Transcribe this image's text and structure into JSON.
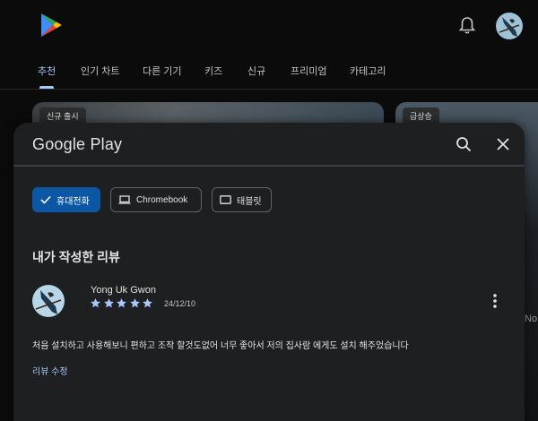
{
  "header": {
    "logo_icon": "google-play-logo",
    "notifications_icon": "bell-icon",
    "account_icon": "avatar"
  },
  "nav": {
    "tabs": [
      {
        "label": "추천",
        "active": true
      },
      {
        "label": "인기 차트",
        "active": false
      },
      {
        "label": "다른 기기",
        "active": false
      },
      {
        "label": "키즈",
        "active": false
      },
      {
        "label": "신규",
        "active": false
      },
      {
        "label": "프리미엄",
        "active": false
      },
      {
        "label": "카테고리",
        "active": false
      }
    ]
  },
  "background": {
    "card_left_chip": "신규 출시",
    "card_right_chip": "급상승",
    "peek_no": "No"
  },
  "dialog": {
    "title": "Google Play",
    "search_icon": "search-icon",
    "close_icon": "close-icon",
    "filters": [
      {
        "label": "휴대전화",
        "icon": "check-icon",
        "selected": true
      },
      {
        "label": "Chromebook",
        "icon": "laptop-icon",
        "selected": false
      },
      {
        "label": "태블릿",
        "icon": "tablet-icon",
        "selected": false
      }
    ],
    "section_title": "내가 작성한 리뷰",
    "review": {
      "author": "Yong Uk Gwon",
      "rating": 5,
      "date": "24/12/10",
      "text": "처음 설치하고 사용해보니 편하고 조작 할것도없어 너무 좋아서 저의 집사람 에게도 설치 해주었습니다",
      "edit_label": "리뷰 수정"
    }
  },
  "colors": {
    "accent": "#a8c7fa",
    "selected_chip": "#0b57a4",
    "dialog_bg": "#1e1f20",
    "page_bg": "#0b0b0c"
  }
}
